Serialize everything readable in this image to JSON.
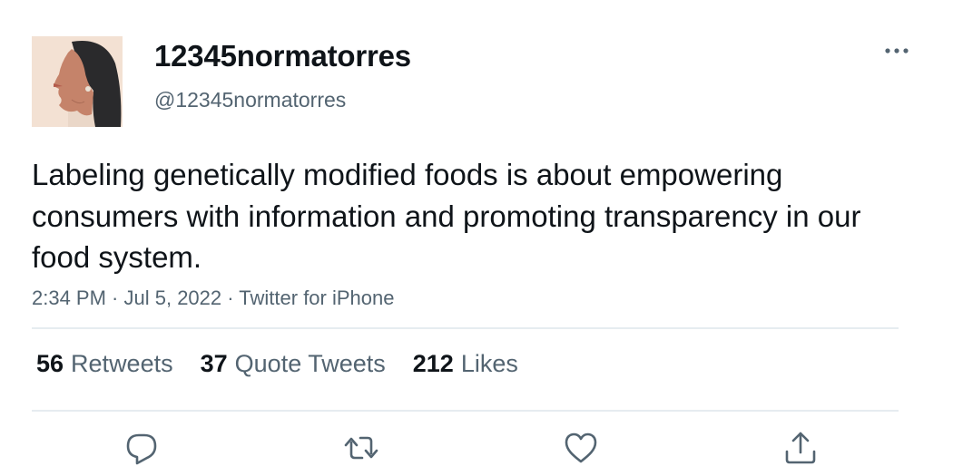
{
  "user": {
    "display_name": "12345normatorres",
    "handle": "@12345normatorres"
  },
  "tweet": {
    "text": "Labeling genetically modified foods is about empowering consumers with information and promoting transparency in our food system.",
    "time": "2:34 PM",
    "date": "Jul 5, 2022",
    "source": "Twitter for iPhone",
    "separator": " · "
  },
  "stats": {
    "retweets": {
      "count": "56",
      "label": "Retweets"
    },
    "quotes": {
      "count": "37",
      "label": "Quote Tweets"
    },
    "likes": {
      "count": "212",
      "label": "Likes"
    }
  },
  "actions": [
    "reply-icon",
    "retweet-icon",
    "like-icon",
    "share-icon"
  ],
  "colors": {
    "text": "#0f1419",
    "secondary": "#536471",
    "divider": "#e6ecf0"
  }
}
